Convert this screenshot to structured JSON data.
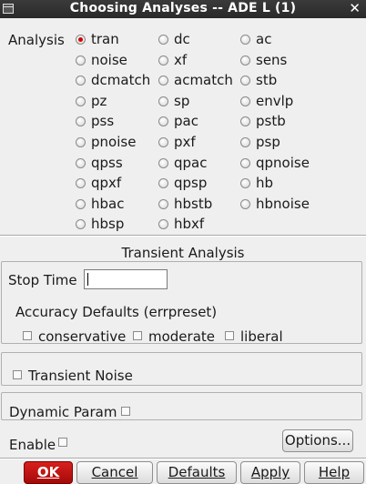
{
  "window": {
    "title": "Choosing Analyses -- ADE L (1)",
    "close_glyph": "✕"
  },
  "analysis": {
    "label": "Analysis",
    "selected": "tran",
    "options": [
      "tran",
      "dc",
      "ac",
      "noise",
      "xf",
      "sens",
      "dcmatch",
      "acmatch",
      "stb",
      "pz",
      "sp",
      "envlp",
      "pss",
      "pac",
      "pstb",
      "pnoise",
      "pxf",
      "psp",
      "qpss",
      "qpac",
      "qpnoise",
      "qpxf",
      "qpsp",
      "hb",
      "hbac",
      "hbstb",
      "hbnoise",
      "hbsp",
      "hbxf"
    ]
  },
  "transient": {
    "section_title": "Transient Analysis",
    "stop_time_label": "Stop Time",
    "stop_time_value": "",
    "accuracy_label": "Accuracy Defaults (errpreset)",
    "accuracy_options": [
      "conservative",
      "moderate",
      "liberal"
    ],
    "transient_noise_label": "Transient Noise",
    "dynamic_param_label": "Dynamic Param",
    "enable_label": "Enable"
  },
  "buttons": {
    "options": "Options...",
    "ok": "OK",
    "cancel": "Cancel",
    "defaults": "Defaults",
    "apply": "Apply",
    "help": "Help"
  }
}
